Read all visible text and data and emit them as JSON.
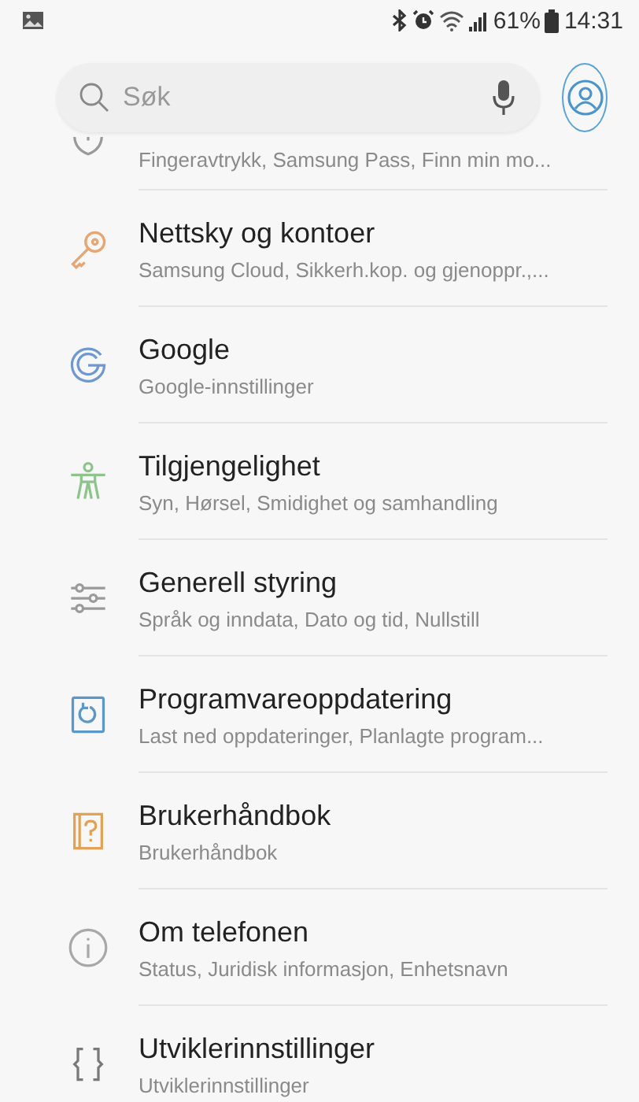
{
  "status_bar": {
    "battery": "61%",
    "time": "14:31"
  },
  "search": {
    "placeholder": "Søk"
  },
  "partial_item": {
    "kind": "lock",
    "color": "#9a9a9a",
    "subtitle": "Fingeravtrykk, Samsung Pass, Finn min mo..."
  },
  "items": [
    {
      "kind": "key",
      "color": "#e8a570",
      "title": "Nettsky og kontoer",
      "subtitle": "Samsung Cloud, Sikkerh.kop. og gjenoppr.,..."
    },
    {
      "kind": "google",
      "color": "#6f98d3",
      "title": "Google",
      "subtitle": "Google-innstillinger"
    },
    {
      "kind": "accessibility",
      "color": "#8cc48c",
      "title": "Tilgjengelighet",
      "subtitle": "Syn, Hørsel, Smidighet og samhandling"
    },
    {
      "kind": "sliders",
      "color": "#9a9a9a",
      "title": "Generell styring",
      "subtitle": "Språk og inndata, Dato og tid, Nullstill"
    },
    {
      "kind": "update",
      "color": "#5b98c8",
      "title": "Programvareoppdatering",
      "subtitle": "Last ned oppdateringer, Planlagte program..."
    },
    {
      "kind": "manual",
      "color": "#e2a256",
      "title": "Brukerhåndbok",
      "subtitle": "Brukerhåndbok"
    },
    {
      "kind": "info",
      "color": "#a8a8a8",
      "title": "Om telefonen",
      "subtitle": "Status, Juridisk informasjon, Enhetsnavn"
    },
    {
      "kind": "braces",
      "color": "#7a7a7a",
      "title": "Utviklerinnstillinger",
      "subtitle": "Utviklerinnstillinger"
    }
  ]
}
